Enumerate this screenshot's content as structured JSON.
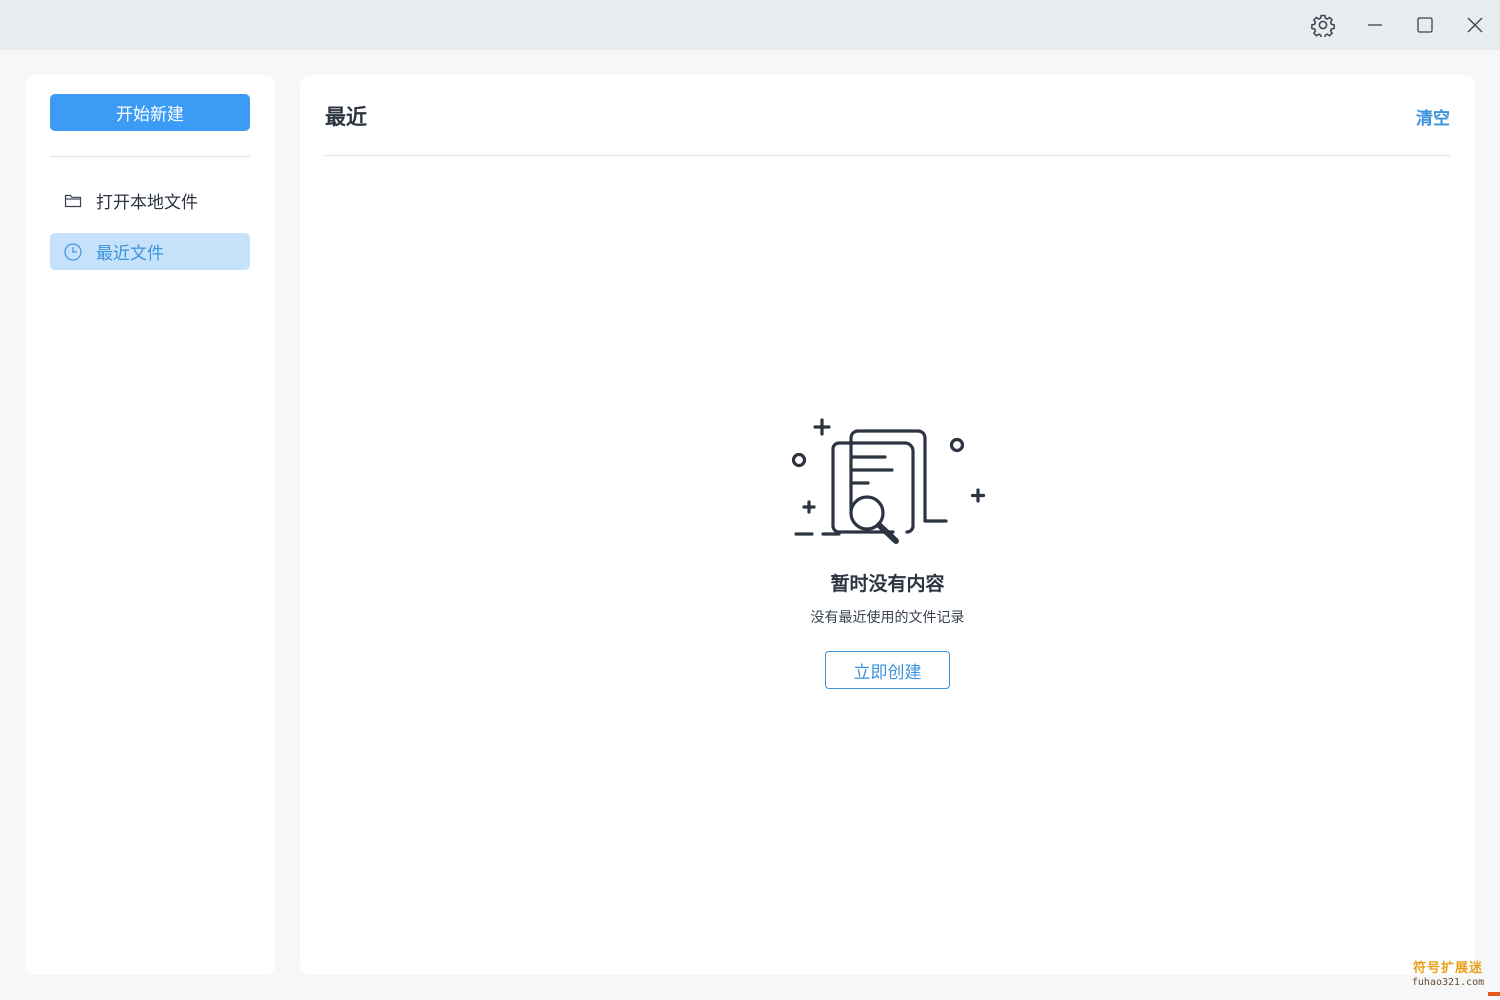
{
  "titlebar": {
    "buttons": [
      "settings-icon",
      "minimize-icon",
      "maximize-icon",
      "close-icon"
    ]
  },
  "sidebar": {
    "new_button_label": "开始新建",
    "items": [
      {
        "label": "打开本地文件",
        "icon": "folder-icon",
        "active": false
      },
      {
        "label": "最近文件",
        "icon": "clock-icon",
        "active": true
      }
    ]
  },
  "main": {
    "title": "最近",
    "clear_label": "清空",
    "empty_state": {
      "illustration": "empty-documents-search-icon",
      "title": "暂时没有内容",
      "subtitle": "没有最近使用的文件记录",
      "button_label": "立即创建"
    }
  },
  "watermark": {
    "cn": "符号扩展迷",
    "en": "fuhao321.com"
  },
  "colors": {
    "accent": "#3c9bf5",
    "accent_text": "#3c93dd",
    "active_bg": "#c6e2fb",
    "titlebar_bg": "#e9ecef",
    "page_bg": "#f5f7f9",
    "text": "#2c3441"
  }
}
